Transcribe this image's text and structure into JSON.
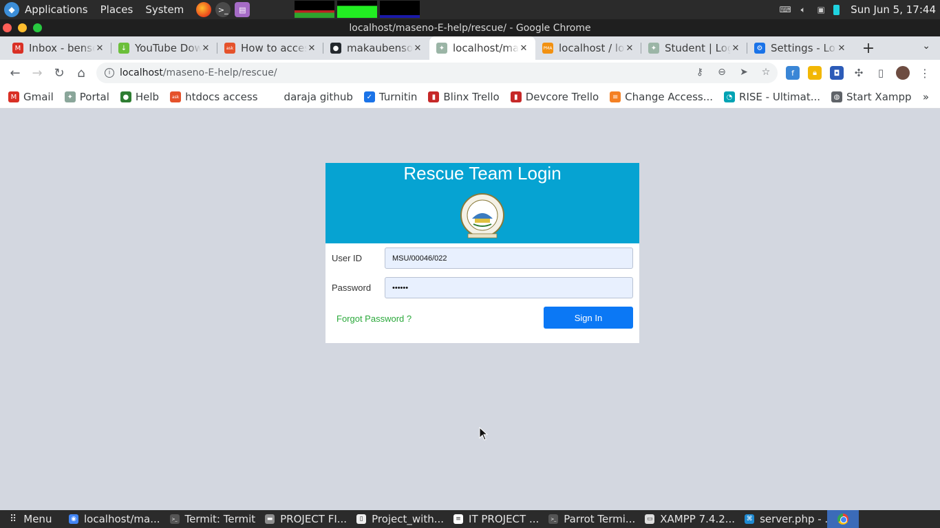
{
  "system_panel": {
    "menus": [
      "Applications",
      "Places",
      "System"
    ],
    "clock": "Sun Jun  5, 17:44"
  },
  "window": {
    "title": "localhost/maseno-E-help/rescue/ - Google Chrome"
  },
  "tabs": [
    {
      "title": "Inbox - benso",
      "favicon": "gmail-icon",
      "color": "#d93025",
      "glyph": "M"
    },
    {
      "title": "YouTube Dow",
      "favicon": "download-icon",
      "color": "#6bbf3a",
      "glyph": "↓"
    },
    {
      "title": "How to acces",
      "favicon": "ask-icon",
      "color": "#e5522b",
      "glyph": "ask"
    },
    {
      "title": "makaubenson",
      "favicon": "github-icon",
      "color": "#24292e",
      "glyph": "●"
    },
    {
      "title": "localhost/ma",
      "favicon": "maseno-icon",
      "color": "#9bb5a6",
      "glyph": "✦"
    },
    {
      "title": "localhost / lo",
      "favicon": "phpmyadmin-icon",
      "color": "#f29111",
      "glyph": "PMA"
    },
    {
      "title": "Student | Log",
      "favicon": "maseno-icon",
      "color": "#9bb5a6",
      "glyph": "✦"
    },
    {
      "title": "Settings - Lo",
      "favicon": "settings-icon",
      "color": "#1a73e8",
      "glyph": "⚙"
    }
  ],
  "active_tab_index": 4,
  "omnibox": {
    "host": "localhost",
    "path": "/maseno-E-help/rescue/"
  },
  "bookmarks": [
    {
      "label": "Gmail",
      "icon": "gmail-icon",
      "color": "#d93025",
      "glyph": "M"
    },
    {
      "label": "Portal",
      "icon": "maseno-icon",
      "color": "#8aa69a",
      "glyph": "✦"
    },
    {
      "label": "Helb",
      "icon": "helb-icon",
      "color": "#2e7d32",
      "glyph": "●"
    },
    {
      "label": "htdocs access",
      "icon": "ask-icon",
      "color": "#e5522b",
      "glyph": "ask"
    },
    {
      "label": "daraja github",
      "icon": "blank-icon",
      "color": "#ffffff",
      "glyph": ""
    },
    {
      "label": "Turnitin",
      "icon": "turnitin-icon",
      "color": "#1a73e8",
      "glyph": "✓"
    },
    {
      "label": "Blinx Trello",
      "icon": "trello-icon",
      "color": "#c62828",
      "glyph": "▮"
    },
    {
      "label": "Devcore Trello",
      "icon": "trello-icon",
      "color": "#c62828",
      "glyph": "▮"
    },
    {
      "label": "Change Access...",
      "icon": "stackoverflow-icon",
      "color": "#f48024",
      "glyph": "≡"
    },
    {
      "label": "RISE - Ultimat...",
      "icon": "rise-icon",
      "color": "#00a3b4",
      "glyph": "◔"
    },
    {
      "label": "Start Xampp",
      "icon": "globe-icon",
      "color": "#5f6368",
      "glyph": "◍"
    }
  ],
  "login": {
    "title": "Rescue Team Login",
    "userid_label": "User ID",
    "userid_value": "MSU/00046/022",
    "password_label": "Password",
    "password_value": "••••••",
    "forgot_link": "Forgot Password ?",
    "signin_button": "Sign In",
    "colors": {
      "header": "#06a3d2",
      "button": "#0b78f5",
      "link": "#2aa83a"
    }
  },
  "taskbar": {
    "menu_label": "Menu",
    "tasks": [
      {
        "label": "localhost/ma...",
        "icon": "chrome-icon",
        "color": "#4285f4",
        "glyph": "◉"
      },
      {
        "label": "Termit: Termit",
        "icon": "terminal-icon",
        "color": "#555555",
        "glyph": ">_"
      },
      {
        "label": "PROJECT FI...",
        "icon": "folder-icon",
        "color": "#8d8d8d",
        "glyph": "▬"
      },
      {
        "label": "Project_with...",
        "icon": "document-icon",
        "color": "#eeeeee",
        "glyph": "▯"
      },
      {
        "label": "IT PROJECT ...",
        "icon": "writer-icon",
        "color": "#ffffff",
        "glyph": "≡"
      },
      {
        "label": "Parrot Termi...",
        "icon": "terminal-icon",
        "color": "#555555",
        "glyph": ">_"
      },
      {
        "label": "XAMPP 7.4.2...",
        "icon": "window-icon",
        "color": "#dddddd",
        "glyph": "▭"
      },
      {
        "label": "server.php - ...",
        "icon": "vscode-icon",
        "color": "#1f8ad2",
        "glyph": "⌘"
      }
    ]
  }
}
